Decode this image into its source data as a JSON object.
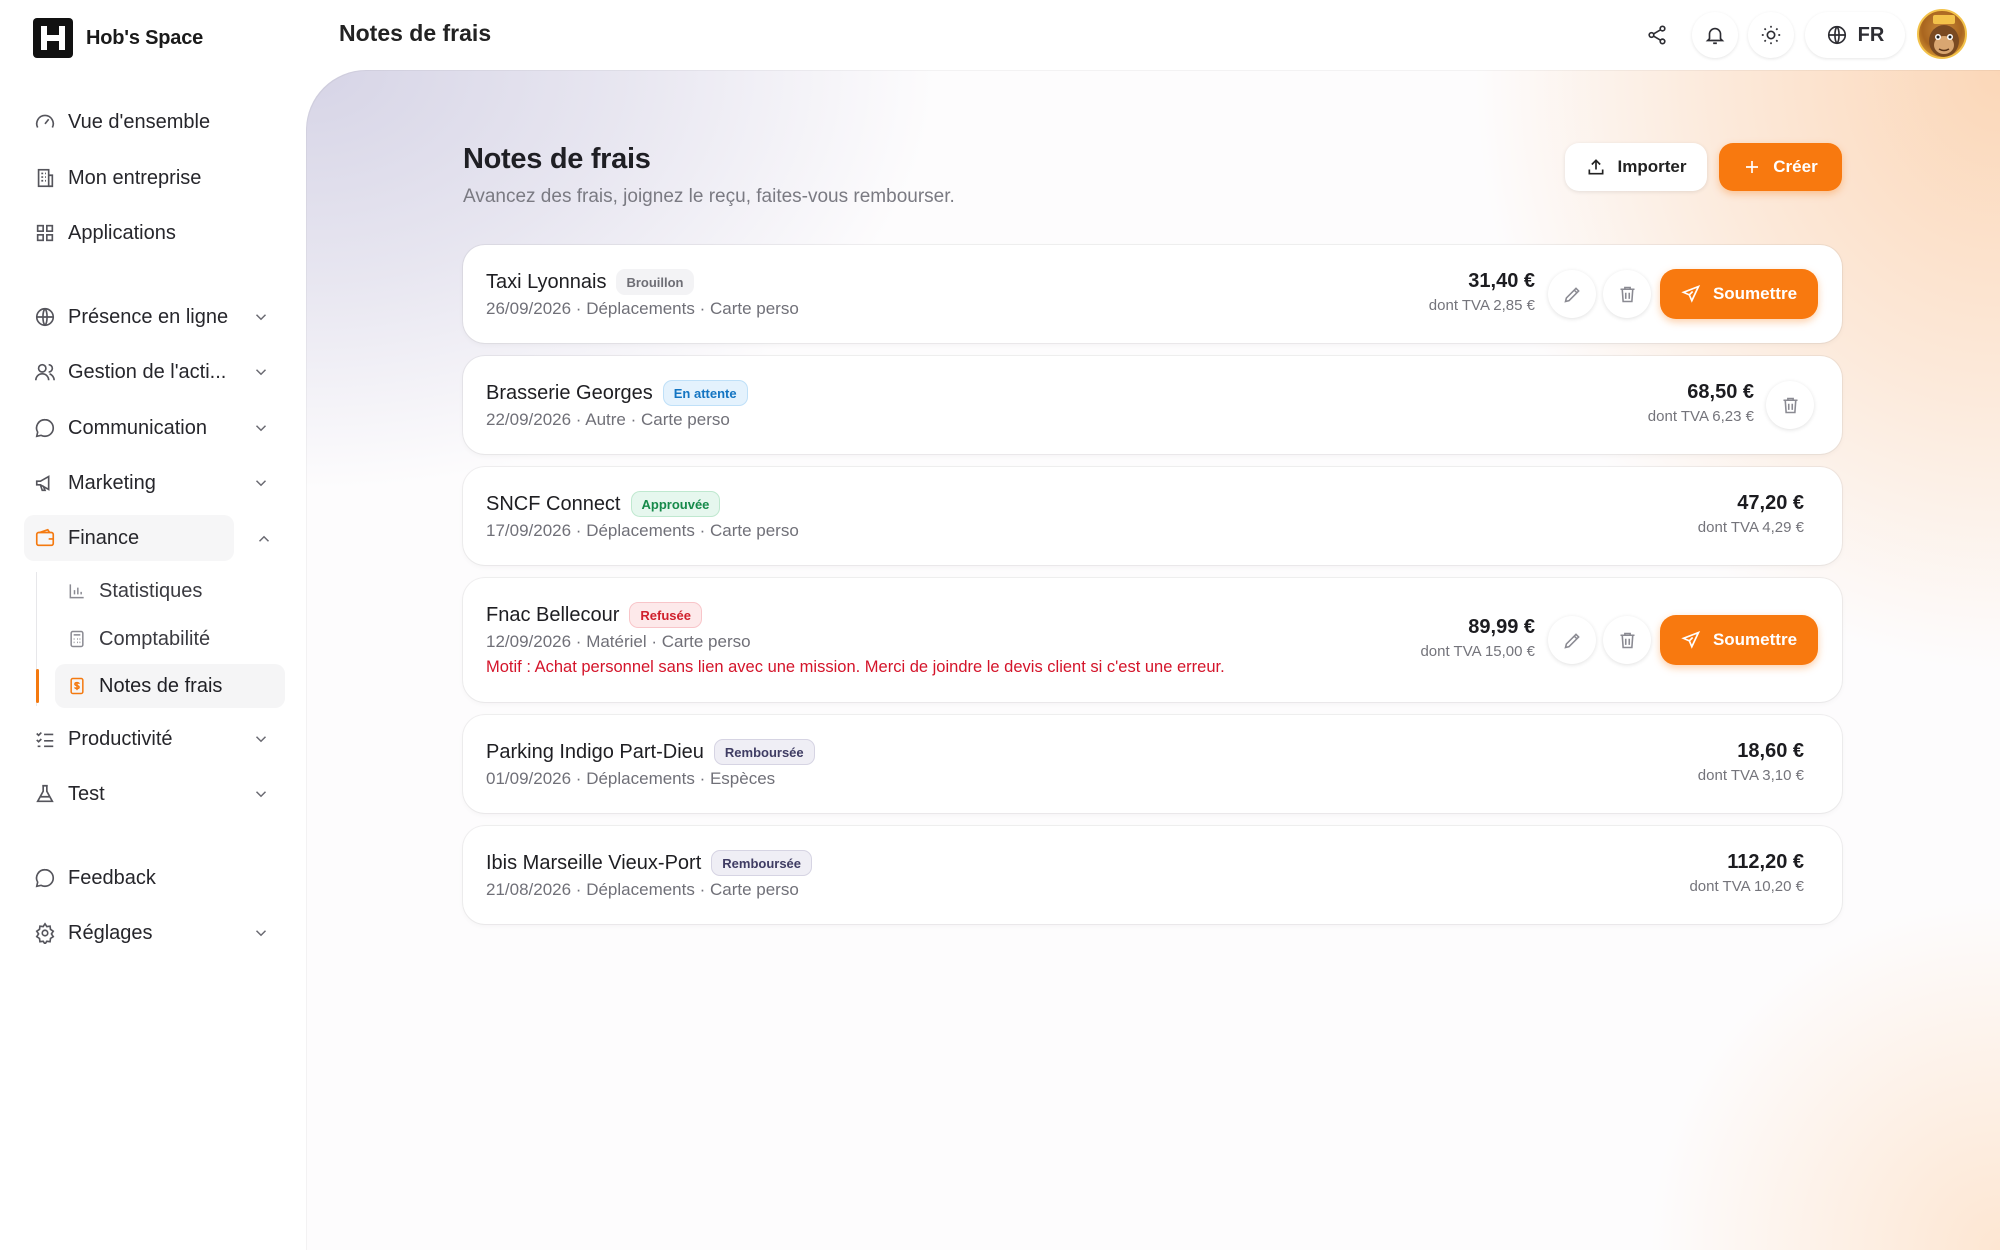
{
  "brand": {
    "name": "Hob's Space"
  },
  "topbar": {
    "title": "Notes de frais",
    "language": "FR"
  },
  "sidebar": {
    "items": [
      {
        "label": "Vue d'ensemble",
        "icon": "gauge-icon"
      },
      {
        "label": "Mon entreprise",
        "icon": "building-icon"
      },
      {
        "label": "Applications",
        "icon": "grid-icon"
      },
      {
        "label": "Présence en ligne",
        "icon": "globe-icon",
        "expandable": true
      },
      {
        "label": "Gestion de l'acti...",
        "icon": "users-icon",
        "expandable": true
      },
      {
        "label": "Communication",
        "icon": "chat-icon",
        "expandable": true
      },
      {
        "label": "Marketing",
        "icon": "megaphone-icon",
        "expandable": true
      },
      {
        "label": "Finance",
        "icon": "wallet-icon",
        "expandable": true,
        "expanded": true,
        "active": true
      },
      {
        "label": "Productivité",
        "icon": "checklist-icon",
        "expandable": true
      },
      {
        "label": "Test",
        "icon": "flask-icon",
        "expandable": true
      },
      {
        "label": "Feedback",
        "icon": "chat-icon"
      },
      {
        "label": "Réglages",
        "icon": "gear-icon",
        "expandable": true
      }
    ],
    "finance_sub": [
      {
        "label": "Statistiques",
        "icon": "bar-chart-icon"
      },
      {
        "label": "Comptabilité",
        "icon": "calculator-icon"
      },
      {
        "label": "Notes de frais",
        "icon": "receipt-icon",
        "active": true
      }
    ]
  },
  "main": {
    "title": "Notes de frais",
    "subtitle": "Avancez des frais, joignez le reçu, faites-vous rembourser.",
    "import_label": "Importer",
    "create_label": "Créer"
  },
  "expenses": [
    {
      "merchant": "Taxi Lyonnais",
      "status": "Brouillon",
      "meta": "26/09/2026 · Déplacements · Carte perso",
      "amount": "31,40 €",
      "tva": "dont TVA 2,85 €",
      "submit_label": "Soumettre"
    },
    {
      "merchant": "Brasserie Georges",
      "status": "En attente",
      "meta": "22/09/2026 · Autre · Carte perso",
      "amount": "68,50 €",
      "tva": "dont TVA 6,23 €"
    },
    {
      "merchant": "SNCF Connect",
      "status": "Approuvée",
      "meta": "17/09/2026 · Déplacements · Carte perso",
      "amount": "47,20 €",
      "tva": "dont TVA 4,29 €"
    },
    {
      "merchant": "Fnac Bellecour",
      "status": "Refusée",
      "meta": "12/09/2026 · Matériel · Carte perso",
      "reason": "Motif : Achat personnel sans lien avec une mission. Merci de joindre le devis client si c'est une erreur.",
      "amount": "89,99 €",
      "tva": "dont TVA 15,00 €",
      "submit_label": "Soumettre"
    },
    {
      "merchant": "Parking Indigo Part-Dieu",
      "status": "Remboursée",
      "meta": "01/09/2026 · Déplacements · Espèces",
      "amount": "18,60 €",
      "tva": "dont TVA 3,10 €"
    },
    {
      "merchant": "Ibis Marseille Vieux-Port",
      "status": "Remboursée",
      "meta": "21/08/2026 · Déplacements · Carte perso",
      "amount": "112,20 €",
      "tva": "dont TVA 10,20 €"
    }
  ],
  "colors": {
    "accent": "#f8790f",
    "refused": "#d4142a"
  }
}
